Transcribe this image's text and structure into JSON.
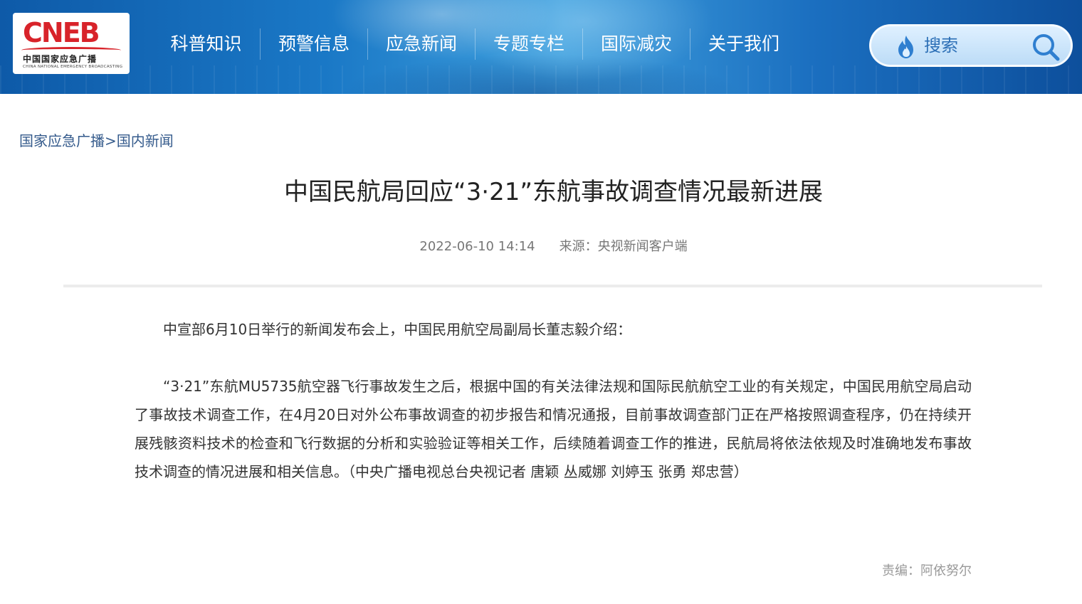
{
  "logo": {
    "mark": "CNEB",
    "name_cn": "中国国家应急广播",
    "name_en": "CHINA NATIONAL EMERGENCY BROADCASTING"
  },
  "nav": {
    "items": [
      {
        "label": "科普知识"
      },
      {
        "label": "预警信息"
      },
      {
        "label": "应急新闻"
      },
      {
        "label": "专题专栏"
      },
      {
        "label": "国际减灾"
      },
      {
        "label": "关于我们"
      }
    ]
  },
  "search": {
    "placeholder": "搜索",
    "flame_icon": "flame-icon",
    "button_icon": "search-icon"
  },
  "breadcrumb": {
    "home": "国家应急广播",
    "separator": ">",
    "current": "国内新闻"
  },
  "article": {
    "title": "中国民航局回应“3·21”东航事故调查情况最新进展",
    "date": "2022-06-10 14:14",
    "source": "来源：央视新闻客户端",
    "paragraphs": [
      "中宣部6月10日举行的新闻发布会上，中国民用航空局副局长董志毅介绍：",
      "“3·21”东航MU5735航空器飞行事故发生之后，根据中国的有关法律法规和国际民航航空工业的有关规定，中国民用航空局启动了事故技术调查工作，在4月20日对外公布事故调查的初步报告和情况通报，目前事故调查部门正在严格按照调查程序，仍在持续开展残骸资料技术的检查和飞行数据的分析和实验验证等相关工作，后续随着调查工作的推进，民航局将依法依规及时准确地发布事故技术调查的情况进展和相关信息。（中央广播电视总台央视记者 唐颖 丛威娜 刘婷玉 张勇 郑忠营）"
    ],
    "editor": "责编：阿依努尔"
  },
  "colors": {
    "brand_red": "#d8232a",
    "header_blue": "#1a78c6",
    "link_blue": "#355b8c"
  }
}
